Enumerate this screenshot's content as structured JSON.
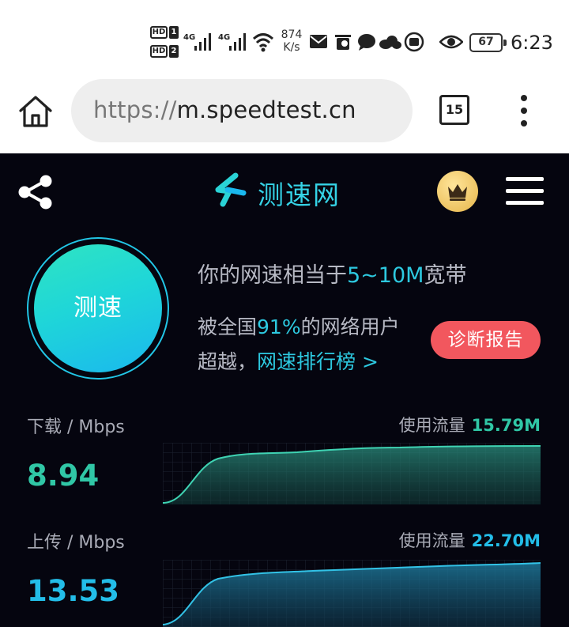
{
  "status_bar": {
    "hd1": "HD",
    "hd1_num": "1",
    "hd2": "HD",
    "hd2_num": "2",
    "net1": "4G",
    "net2": "4G",
    "speed_value": "874",
    "speed_unit": "K/s",
    "battery": "67",
    "time": "6:23"
  },
  "browser": {
    "url_scheme": "https://",
    "url_host": "m.speedtest.cn",
    "tab_count": "15"
  },
  "app": {
    "logo_text": "测速网",
    "dial_label": "测速",
    "info": {
      "prefix": "你的网速相当于",
      "bandwidth": "5~10M",
      "suffix": "宽带",
      "beat_prefix": "被全国",
      "beat_percent": "91%",
      "beat_suffix": "的网络用户",
      "exceed_label": "超越，",
      "rank_link": "网速排行榜 >"
    },
    "report_button": "诊断报告",
    "download": {
      "label": "下载 / Mbps",
      "value": "8.94",
      "traffic_label": "使用流量",
      "traffic_value": "15.79M",
      "color": "#30c7a6"
    },
    "upload": {
      "label": "上传 / Mbps",
      "value": "13.53",
      "traffic_label": "使用流量",
      "traffic_value": "22.70M",
      "color": "#23bde8"
    },
    "colors": {
      "accent": "#2dc9e0",
      "report": "#f2575e",
      "background": "#05050f"
    }
  },
  "icons": [
    "home-icon",
    "share-icon",
    "crown-icon",
    "menu-icon",
    "more-icon",
    "wifi-icon",
    "mail-icon",
    "chat-icon",
    "cloud-icon",
    "eye-icon"
  ]
}
